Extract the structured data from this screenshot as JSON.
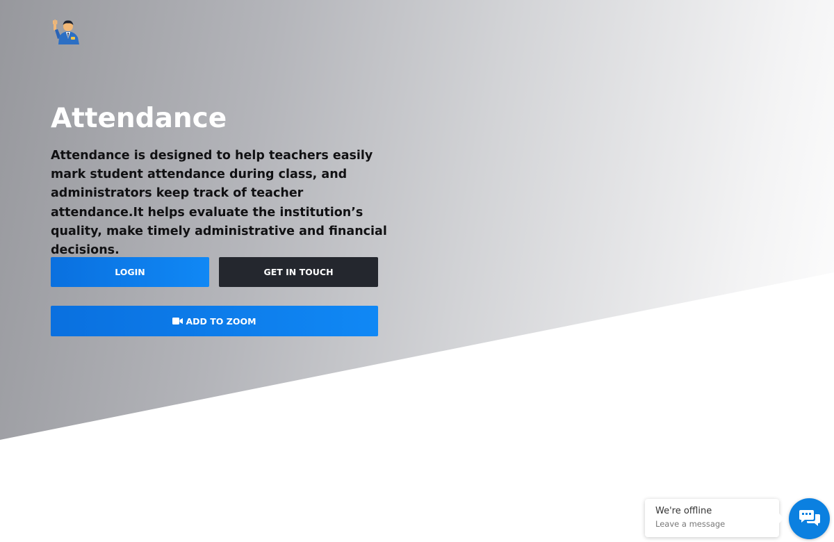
{
  "header": {
    "logo_icon": "person-waving-icon"
  },
  "hero": {
    "title": "Attendance",
    "description": "Attendance is designed to help teachers easily mark student attendance during class, and administrators keep track of teacher attendance.It helps evaluate the institution’s quality, make timely administrative and financial decisions.",
    "login_label": "LOGIN",
    "touch_label": "GET IN TOUCH",
    "zoom_label": "ADD TO ZOOM",
    "zoom_icon": "video-camera-icon"
  },
  "chat": {
    "status": "We're offline",
    "prompt": "Leave a message",
    "icon": "chat-bubbles-icon"
  },
  "colors": {
    "primary": "#0a7ae8",
    "dark_button": "#24272e",
    "chat_accent": "#0b80e0",
    "hero_gradient_start": "#97989d",
    "hero_gradient_end": "#ffffff"
  }
}
